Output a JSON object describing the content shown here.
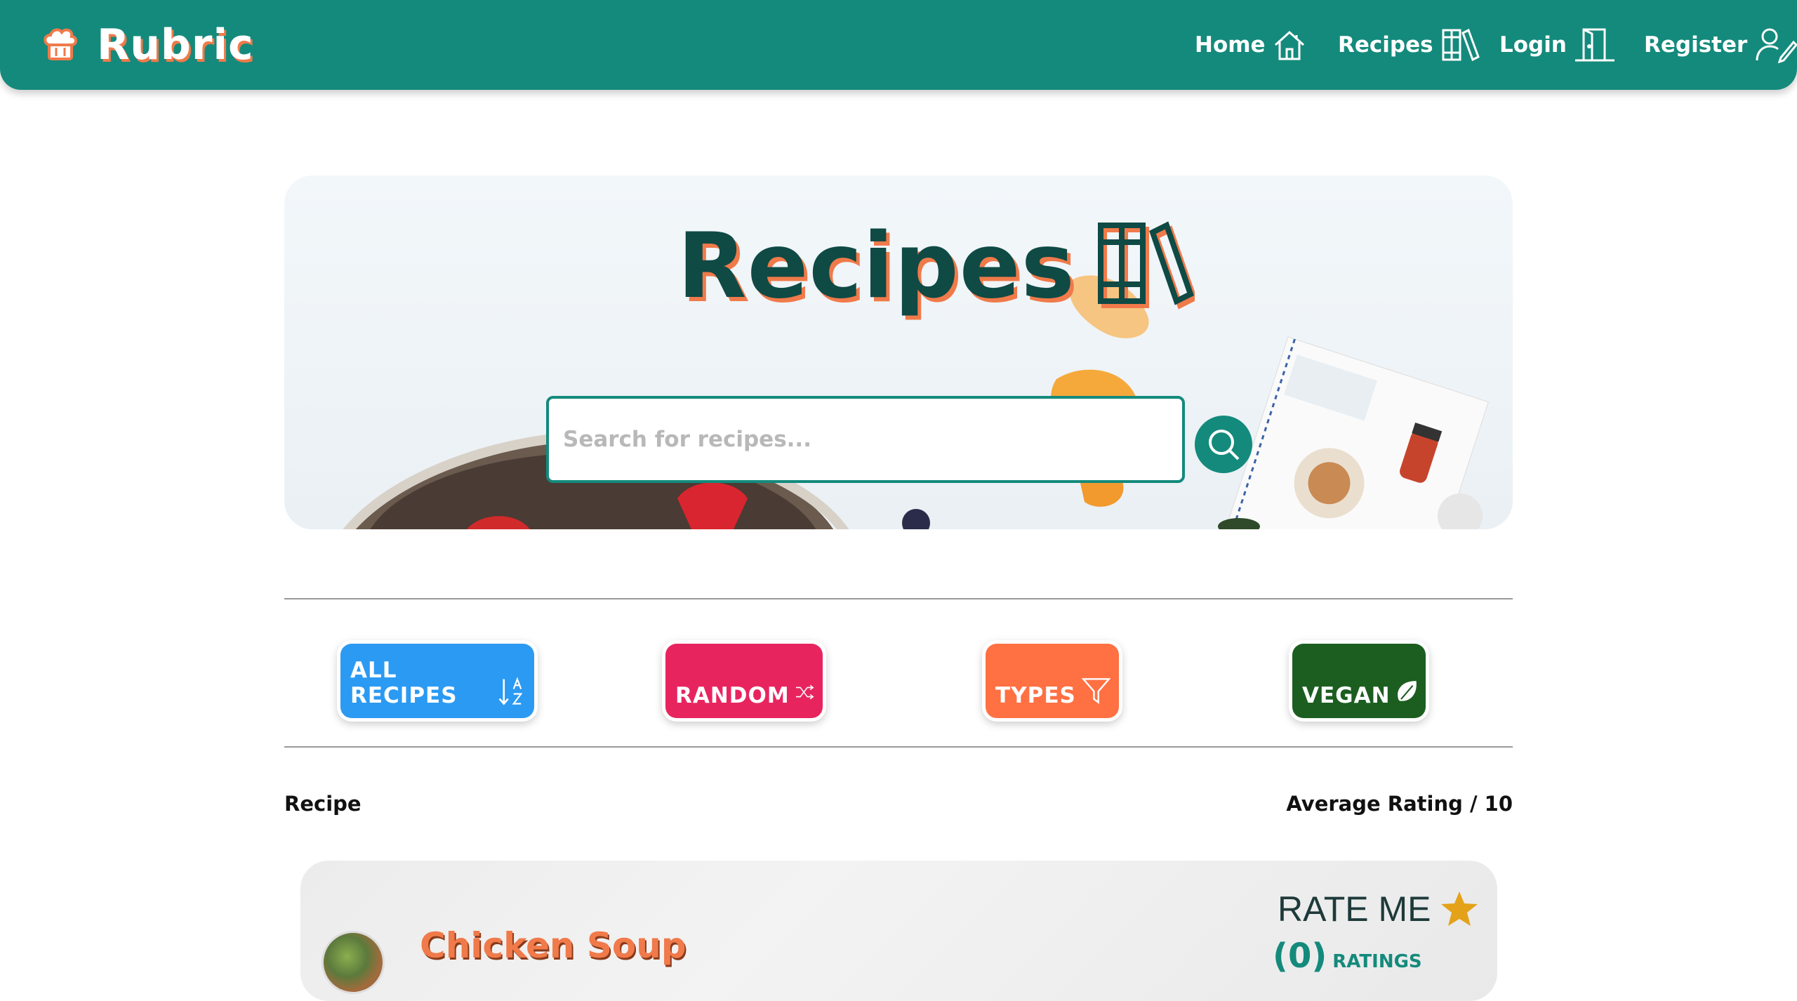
{
  "brand": {
    "name": "Rubric"
  },
  "nav": {
    "home": "Home",
    "recipes": "Recipes",
    "login": "Login",
    "register": "Register"
  },
  "hero": {
    "title": "Recipes",
    "search_placeholder": "Search for recipes..."
  },
  "categories": {
    "all": "ALL RECIPES",
    "random": "RANDOM",
    "types": "TYPES",
    "vegan": "VEGAN"
  },
  "colors": {
    "primary": "#148a7c",
    "accent": "#f07a4a",
    "all": "#2b9af3",
    "random": "#e8245f",
    "types": "#ff7043",
    "vegan": "#1b5e20"
  },
  "table": {
    "col_recipe": "Recipe",
    "col_rating": "Average Rating / 10"
  },
  "recipes": [
    {
      "name": "Chicken Soup",
      "rate_label": "RATE ME",
      "ratings_count": "(0)",
      "ratings_label": "RATINGS"
    }
  ]
}
